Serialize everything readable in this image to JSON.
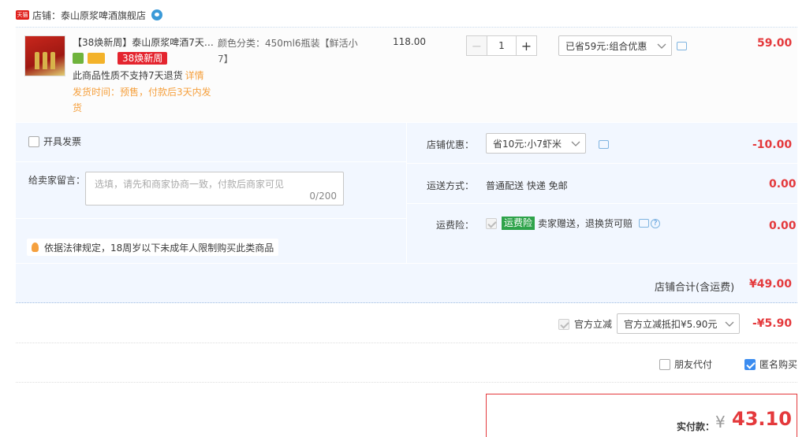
{
  "store": {
    "badge": "天猫",
    "prefix": "店铺：",
    "name": "泰山原浆啤酒旗舰店"
  },
  "item": {
    "title": "【38焕新周】泰山原浆啤酒7天…",
    "promo_tag": "38焕新周",
    "no_return": "此商品性质不支持7天退货",
    "detail_link": "详情",
    "ship_time": "发货时间：预售，付款后3天内发货",
    "spec": "颜色分类：450ml6瓶装【鲜活小7】",
    "unit_price": "118.00",
    "quantity": "1",
    "minus": "−",
    "plus": "+",
    "discount_option": "已省59元:组合优惠",
    "subtotal": "59.00"
  },
  "options": {
    "invoice_label": "开具发票",
    "message_label": "给卖家留言：",
    "message_placeholder": "选填，请先和商家协商一致，付款后商家可见",
    "message_count": "0/200",
    "law_note": "依据法律规定，18周岁以下未成年人限制购买此类商品"
  },
  "shop_coupon": {
    "label": "店铺优惠：",
    "selected": "省10元:小7虾米",
    "amount": "-10.00"
  },
  "shipping": {
    "label": "运送方式：",
    "value": "普通配送 快递 免邮",
    "amount": "0.00"
  },
  "insurance": {
    "label": "运费险：",
    "tag": "运费险",
    "text": "卖家赠送，退换货可赔",
    "help": "?",
    "amount": "0.00"
  },
  "store_total": {
    "label": "店铺合计(含运费)",
    "amount": "¥49.00"
  },
  "official": {
    "label": "官方立减",
    "selected": "官方立减抵扣¥5.90元",
    "amount": "-¥5.90"
  },
  "friend_pay_label": "朋友代付",
  "anonymous_label": "匿名购买",
  "payment": {
    "label": "实付款：",
    "currency": "¥",
    "amount": "43.10"
  },
  "colors": {
    "accent_red": "#e4393c",
    "panel_blue": "#f2f7ff",
    "orange_note": "#f5a03e",
    "checkbox_blue": "#3b8cf0",
    "insurance_green": "#2ea34a"
  },
  "icons": [
    "tmall-icon",
    "wangwang-icon",
    "chat-icon",
    "help-icon",
    "bulb-icon",
    "chevron-down-icon"
  ]
}
